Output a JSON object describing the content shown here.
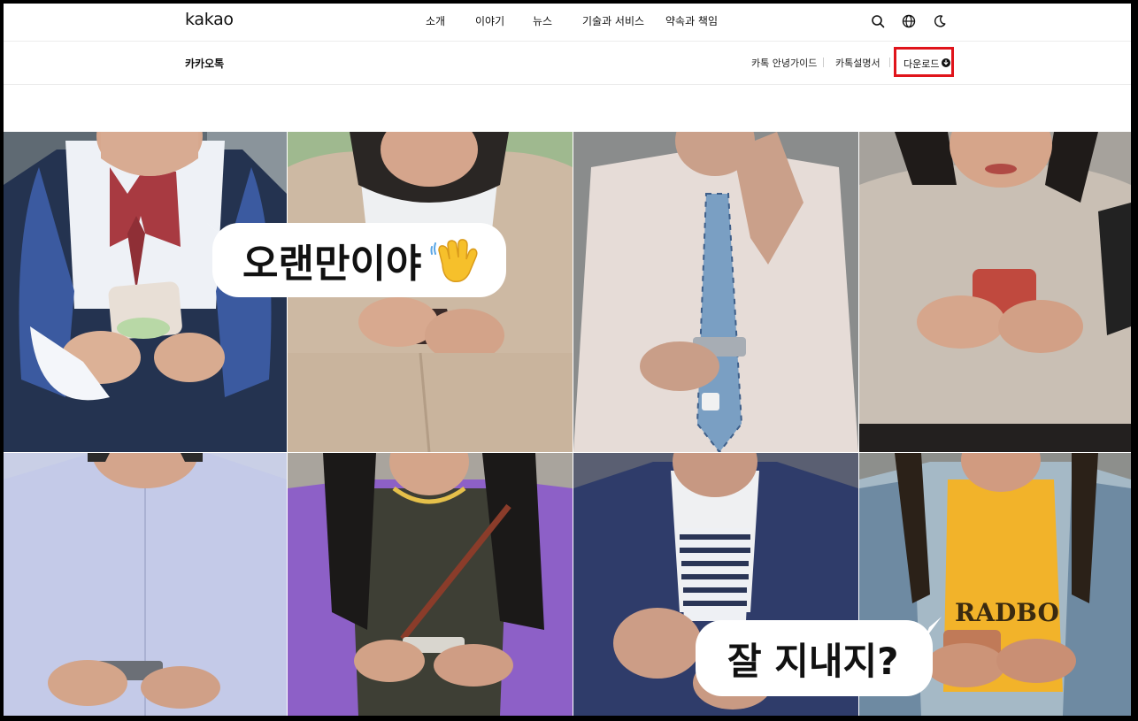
{
  "brand": {
    "logo": "kakao"
  },
  "nav": {
    "items": [
      {
        "label": "소개"
      },
      {
        "label": "이야기"
      },
      {
        "label": "뉴스"
      },
      {
        "label": "기술과 서비스"
      },
      {
        "label": "약속과 책임"
      }
    ],
    "tools": [
      {
        "icon": "search-icon"
      },
      {
        "icon": "globe-icon"
      },
      {
        "icon": "moon-icon"
      }
    ]
  },
  "subnav": {
    "service": "카카오톡",
    "links": [
      {
        "label": "카톡 안녕가이드"
      },
      {
        "label": "카톡설명서"
      }
    ],
    "download": {
      "label": "다운로드",
      "icon": "download-icon"
    }
  },
  "hero": {
    "bubble1": "오랜만이야",
    "bubble1_emoji": "waving-hand-icon",
    "bubble2": "잘 지내지?"
  },
  "colors": {
    "highlight": "#e0141b"
  }
}
